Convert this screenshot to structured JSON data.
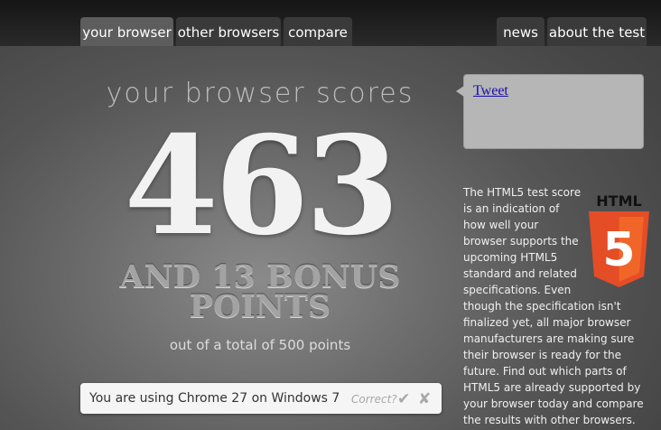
{
  "nav": {
    "left_tabs": [
      {
        "label": "your browser",
        "active": true
      },
      {
        "label": "other browsers",
        "active": false
      },
      {
        "label": "compare",
        "active": false
      }
    ],
    "right_tabs": [
      {
        "label": "news",
        "active": false
      },
      {
        "label": "about the test",
        "active": false
      }
    ]
  },
  "result": {
    "heading": "your browser scores",
    "score": "463",
    "bonus": "AND 13 BONUS POINTS",
    "total": "out of a total of 500 points"
  },
  "browser_box": {
    "text": "You are using Chrome 27 on Windows 7",
    "correct_label": "Correct?",
    "confirm_icon": "check-icon",
    "reject_icon": "cross-icon"
  },
  "tweet": {
    "label": "Tweet"
  },
  "sidebar": {
    "logo_text": "HTML",
    "logo_number": "5",
    "description": "The HTML5 test score is an indication of how well your browser supports the upcoming HTML5 standard and related specifications. Even though the specification isn't finalized yet, all major browser manufacturers are making sure their browser is ready for the future. Find out which parts of HTML5 are already supported by your browser today and compare the results with other browsers."
  },
  "colors": {
    "html5_orange": "#e44d26",
    "html5_orange_light": "#f16529",
    "link_blue": "#1a0dab"
  }
}
